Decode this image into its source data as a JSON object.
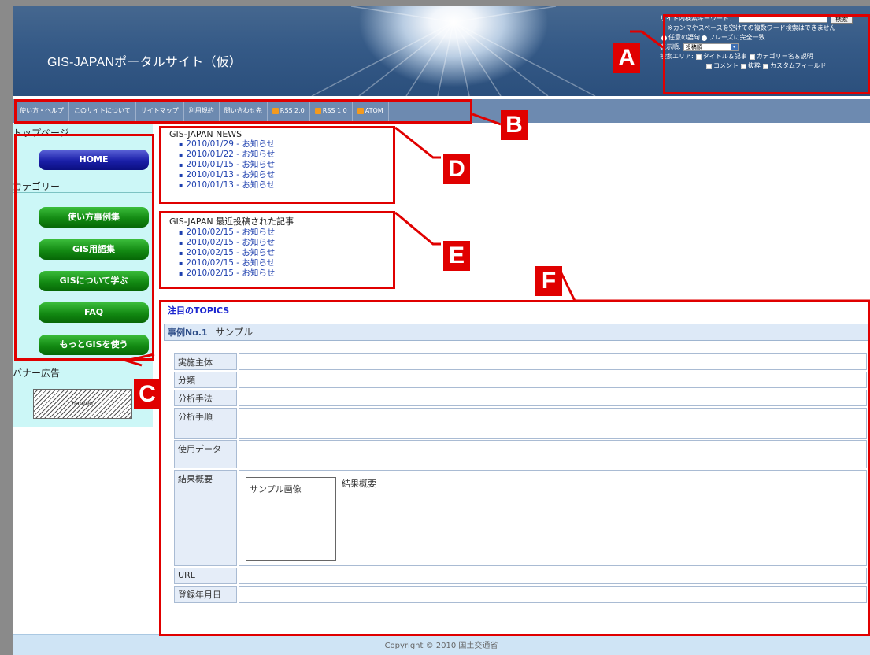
{
  "header": {
    "site_title": "GIS-JAPANポータルサイト（仮）"
  },
  "search": {
    "keyword_label": "サイト内検索キーワード：",
    "button": "検索",
    "note": "※カンマやスペースを空けての複数ワード検索はできません",
    "mode_any": "任意の語句",
    "mode_phrase": "フレーズに完全一致",
    "order_label": "表示順:",
    "order_value": "投稿順",
    "area_label": "検索エリア:",
    "area_title": "タイトル＆記事",
    "area_category": "カテゴリー名＆説明",
    "area_comment": "コメント",
    "area_excerpt": "抜粋",
    "area_custom": "カスタムフィールド"
  },
  "nav": {
    "items": [
      "使い方・ヘルプ",
      "このサイトについて",
      "サイトマップ",
      "利用規約",
      "問い合わせ先"
    ],
    "rss": [
      "RSS 2.0",
      "RSS 1.0",
      "ATOM"
    ],
    "rss_color": "#f39a1e"
  },
  "sidebar": {
    "top_heading": "トップページ",
    "home": "HOME",
    "category_heading": "カテゴリー",
    "categories": [
      "使い方事例集",
      "GIS用語集",
      "GISについて学ぶ",
      "FAQ",
      "もっとGISを使う"
    ],
    "banner_heading": "バナー広告",
    "banner_text": "banner"
  },
  "news": {
    "title": "GIS-JAPAN NEWS",
    "items": [
      "2010/01/29 - お知らせ",
      "2010/01/22 - お知らせ",
      "2010/01/15 - お知らせ",
      "2010/01/13 - お知らせ",
      "2010/01/13 - お知らせ"
    ]
  },
  "recent": {
    "title": "GIS-JAPAN 最近投稿された記事",
    "items": [
      "2010/02/15 - お知らせ",
      "2010/02/15 - お知らせ",
      "2010/02/15 - お知らせ",
      "2010/02/15 - お知らせ",
      "2010/02/15 - お知らせ"
    ]
  },
  "topics": {
    "title": "注目のTOPICS",
    "case_no": "事例No.1",
    "case_name": "サンプル",
    "rows": [
      "実施主体",
      "分類",
      "分析手法",
      "分析手順",
      "使用データ",
      "結果概要",
      "URL",
      "登録年月日"
    ],
    "sample_image": "サンプル画像",
    "result_summary": "結果概要"
  },
  "footer": {
    "copyright": "Copyright © 2010 国土交通省"
  },
  "annotations": {
    "labels": [
      "A",
      "B",
      "C",
      "D",
      "E",
      "F"
    ],
    "color": "#e00000"
  }
}
